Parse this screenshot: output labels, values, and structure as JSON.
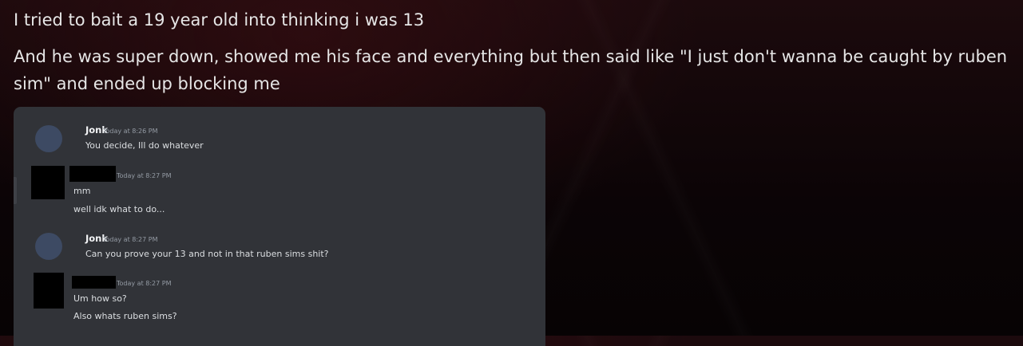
{
  "post": {
    "title": "I tried to bait a 19 year old into thinking i was 13",
    "body": "And he was super down, showed me his face and everything but then said like \"I just don't wanna be caught by ruben sim\" and ended up blocking me"
  },
  "chat": {
    "messages": [
      {
        "author": "Jonk",
        "timestamp": "Today at 8:26 PM",
        "lines": [
          "You decide, Ill do whatever"
        ]
      },
      {
        "author": "",
        "timestamp": "Today at 8:27 PM",
        "lines": [
          "mm",
          "well idk what to do..."
        ]
      },
      {
        "author": "Jonk",
        "timestamp": "Today at 8:27 PM",
        "lines": [
          "Can you prove your 13 and not in that ruben sims shit?"
        ]
      },
      {
        "author": "",
        "timestamp": "Today at 8:27 PM",
        "lines": [
          "Um how so?",
          "Also whats ruben sims?"
        ]
      }
    ]
  },
  "colors": {
    "chat_background": "#313338",
    "page_background": "#0c0507",
    "avatar_placeholder": "#3d4a63",
    "redaction": "#000000"
  }
}
